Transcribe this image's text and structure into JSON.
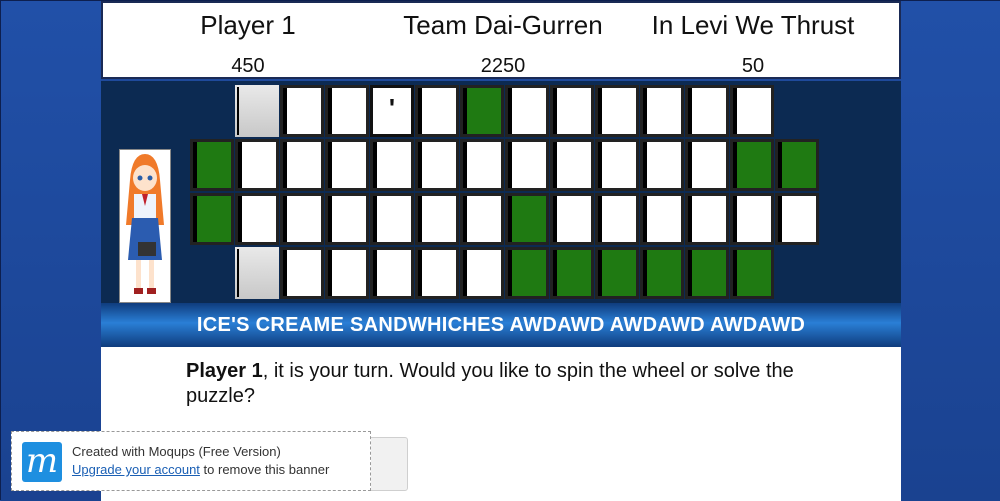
{
  "players": [
    {
      "name": "Player 1",
      "score": "450"
    },
    {
      "name": "Team Dai-Gurren",
      "score": "2250"
    },
    {
      "name": "In Levi We Thrust",
      "score": "50"
    }
  ],
  "board": {
    "revealed_letters": [
      "'"
    ],
    "category": "ICE'S CREAME SANDWHICHES AWDAWD AWDAWD AWDAWD"
  },
  "turn": {
    "player": "Player 1",
    "message": ", it is your turn. Would you like to spin the wheel or solve the puzzle?"
  },
  "banner": {
    "line1": "Created with Moqups (Free Version)",
    "link": "Upgrade your account",
    "line2_rest": " to remove this banner",
    "logo_glyph": "m"
  },
  "colors": {
    "side": "#1f4a9c",
    "board": "#0c2a52",
    "tile_green": "#1f7a12"
  }
}
